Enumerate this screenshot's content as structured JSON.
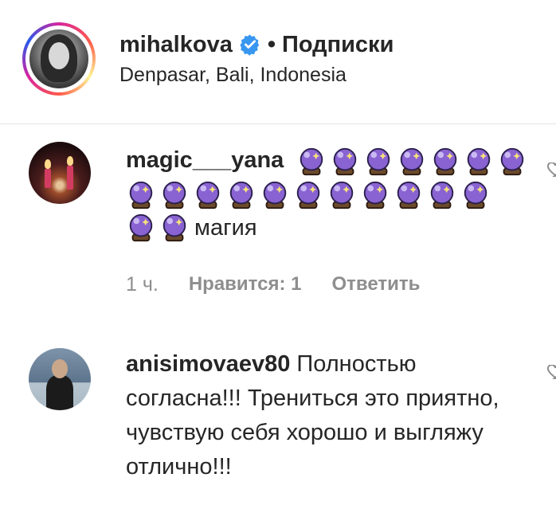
{
  "post_header": {
    "username": "mihalkova",
    "separator": "•",
    "follow_label": "Подписки",
    "location": "Denpasar, Bali, Indonesia"
  },
  "comments": [
    {
      "username": "magic___yana",
      "text": "магия",
      "emoji": "crystal-ball",
      "emoji_rows": [
        7,
        11,
        2
      ],
      "time": "1 ч.",
      "likes": "Нравится: 1",
      "reply": "Ответить"
    },
    {
      "username": "anisimovaev80",
      "text": "Полностью согласна!!! Трениться это приятно, чувствую себя хорошо и выгляжу отлично!!!"
    }
  ],
  "colors": {
    "text": "#262626",
    "muted": "#8e8e8e",
    "verified_blue": "#3897f0",
    "orb_purple": "#8a63d2"
  }
}
